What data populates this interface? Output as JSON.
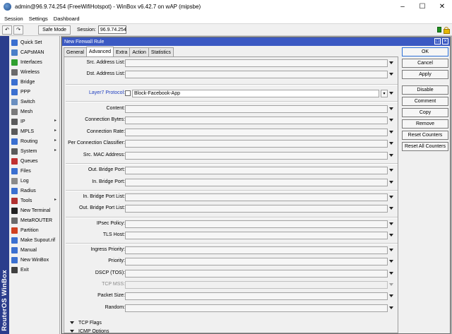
{
  "window": {
    "title": "admin@96.9.74.254 (FreeWifiHotspot) - WinBox v6.42.7 on wAP (mipsbe)",
    "minimize": "–",
    "maximize": "☐",
    "close": "✕"
  },
  "menu": [
    "Session",
    "Settings",
    "Dashboard"
  ],
  "toolbar": {
    "undo": "↶",
    "redo": "↷",
    "safe_mode": "Safe Mode",
    "session_label": "Session:",
    "session_value": "96.9.74.254"
  },
  "brand": "RouterOS WinBox",
  "sidebar": [
    {
      "label": "Quick Set",
      "icon": "quick-set-icon",
      "color": "#3a6fd0",
      "submenu": false
    },
    {
      "label": "CAPsMAN",
      "icon": "capsman-icon",
      "color": "#4a7fc8",
      "submenu": false
    },
    {
      "label": "Interfaces",
      "icon": "interfaces-icon",
      "color": "#2f9f2f",
      "submenu": false
    },
    {
      "label": "Wireless",
      "icon": "wireless-icon",
      "color": "#6a6a6a",
      "submenu": false
    },
    {
      "label": "Bridge",
      "icon": "bridge-icon",
      "color": "#3a6fd0",
      "submenu": false
    },
    {
      "label": "PPP",
      "icon": "ppp-icon",
      "color": "#3a6fd0",
      "submenu": false
    },
    {
      "label": "Switch",
      "icon": "switch-icon",
      "color": "#6a8fc0",
      "submenu": false
    },
    {
      "label": "Mesh",
      "icon": "mesh-icon",
      "color": "#7a7a7a",
      "submenu": false
    },
    {
      "label": "IP",
      "icon": "ip-icon",
      "color": "#5a5a5a",
      "submenu": true
    },
    {
      "label": "MPLS",
      "icon": "mpls-icon",
      "color": "#5a5a5a",
      "submenu": true
    },
    {
      "label": "Routing",
      "icon": "routing-icon",
      "color": "#3a6fd0",
      "submenu": true
    },
    {
      "label": "System",
      "icon": "system-icon",
      "color": "#5a5a5a",
      "submenu": true
    },
    {
      "label": "Queues",
      "icon": "queues-icon",
      "color": "#c03030",
      "submenu": false
    },
    {
      "label": "Files",
      "icon": "files-icon",
      "color": "#3a6fd0",
      "submenu": false
    },
    {
      "label": "Log",
      "icon": "log-icon",
      "color": "#8a8a8a",
      "submenu": false
    },
    {
      "label": "Radius",
      "icon": "radius-icon",
      "color": "#3a6fd0",
      "submenu": false
    },
    {
      "label": "Tools",
      "icon": "tools-icon",
      "color": "#b03030",
      "submenu": true
    },
    {
      "label": "New Terminal",
      "icon": "terminal-icon",
      "color": "#222222",
      "submenu": false
    },
    {
      "label": "MetaROUTER",
      "icon": "metarouter-icon",
      "color": "#6a6a6a",
      "submenu": false
    },
    {
      "label": "Partition",
      "icon": "partition-icon",
      "color": "#d04020",
      "submenu": false
    },
    {
      "label": "Make Supout.rif",
      "icon": "supout-icon",
      "color": "#3a6fd0",
      "submenu": false
    },
    {
      "label": "Manual",
      "icon": "manual-icon",
      "color": "#3a6fd0",
      "submenu": false
    },
    {
      "label": "New WinBox",
      "icon": "winbox-icon",
      "color": "#3a6fd0",
      "submenu": false
    },
    {
      "label": "Exit",
      "icon": "exit-icon",
      "color": "#404040",
      "submenu": false
    }
  ],
  "dialog": {
    "title": "New Firewall Rule",
    "tabs": [
      "General",
      "Advanced",
      "Extra",
      "Action",
      "Statistics"
    ],
    "active_tab": "Advanced",
    "fields": [
      {
        "label": "Src. Address List:",
        "value": ""
      },
      {
        "label": "Dst. Address List:",
        "value": ""
      },
      {
        "label": "Layer7 Protocol:",
        "value": "Block-Facebook-App"
      },
      {
        "label": "Content:",
        "value": ""
      },
      {
        "label": "Connection Bytes:",
        "value": ""
      },
      {
        "label": "Connection Rate:",
        "value": ""
      },
      {
        "label": "Per Connection Classifier:",
        "value": ""
      },
      {
        "label": "Src. MAC Address:",
        "value": ""
      },
      {
        "label": "Out. Bridge Port:",
        "value": ""
      },
      {
        "label": "In. Bridge Port:",
        "value": ""
      },
      {
        "label": "In. Bridge Port List:",
        "value": ""
      },
      {
        "label": "Out. Bridge Port List:",
        "value": ""
      },
      {
        "label": "IPsec Policy:",
        "value": ""
      },
      {
        "label": "TLS Host:",
        "value": ""
      },
      {
        "label": "Ingress Priority:",
        "value": ""
      },
      {
        "label": "Priority:",
        "value": ""
      },
      {
        "label": "DSCP (TOS):",
        "value": ""
      },
      {
        "label": "TCP MSS:",
        "value": ""
      },
      {
        "label": "Packet Size:",
        "value": ""
      },
      {
        "label": "Random:",
        "value": ""
      }
    ],
    "sections": [
      "TCP Flags",
      "ICMP Options"
    ],
    "buttons": [
      "OK",
      "Cancel",
      "Apply",
      "Disable",
      "Comment",
      "Copy",
      "Remove",
      "Reset Counters",
      "Reset All Counters"
    ]
  }
}
